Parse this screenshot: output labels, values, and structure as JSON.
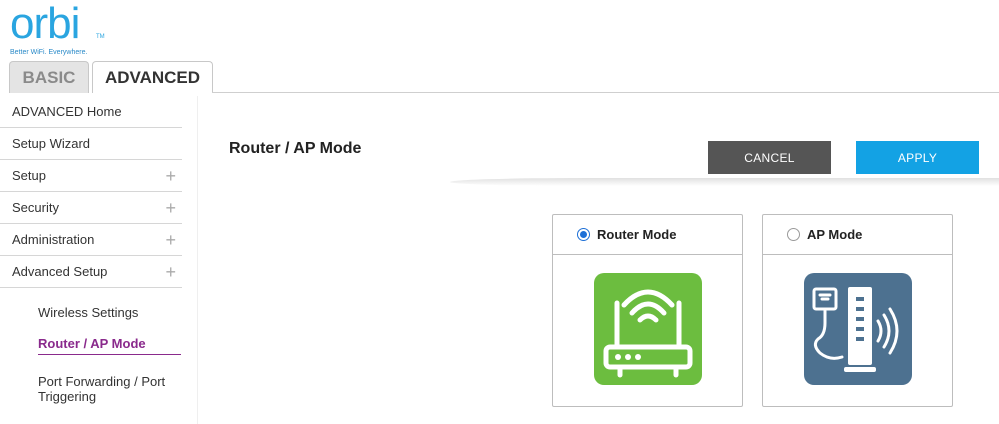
{
  "brand": {
    "logo": "orbi",
    "trademark": "TM",
    "tagline": "Better WiFi. Everywhere."
  },
  "tabs": {
    "basic": "BASIC",
    "advanced": "ADVANCED"
  },
  "sidebar": {
    "items": [
      {
        "label": "ADVANCED Home",
        "expandable": false
      },
      {
        "label": "Setup Wizard",
        "expandable": false
      },
      {
        "label": "Setup",
        "expandable": true
      },
      {
        "label": "Security",
        "expandable": true
      },
      {
        "label": "Administration",
        "expandable": true
      },
      {
        "label": "Advanced Setup",
        "expandable": true
      }
    ],
    "expand_symbol": "+",
    "subitems": [
      {
        "label": "Wireless Settings",
        "active": false
      },
      {
        "label": "Router / AP Mode",
        "active": true
      },
      {
        "label": "Port Forwarding / Port Triggering",
        "active": false
      }
    ]
  },
  "main": {
    "title": "Router / AP Mode",
    "cancel_label": "CANCEL",
    "apply_label": "APPLY",
    "modes": [
      {
        "label": "Router Mode",
        "selected": true,
        "icon": "router-icon"
      },
      {
        "label": "AP Mode",
        "selected": false,
        "icon": "access-point-icon"
      }
    ]
  },
  "colors": {
    "brand_blue": "#2aa5e0",
    "apply_blue": "#13a2e4",
    "cancel_gray": "#555555",
    "active_purple": "#8a2a8c",
    "router_green": "#6cbd3f",
    "ap_slate": "#4d7190",
    "radio_blue": "#1d6fd6"
  }
}
